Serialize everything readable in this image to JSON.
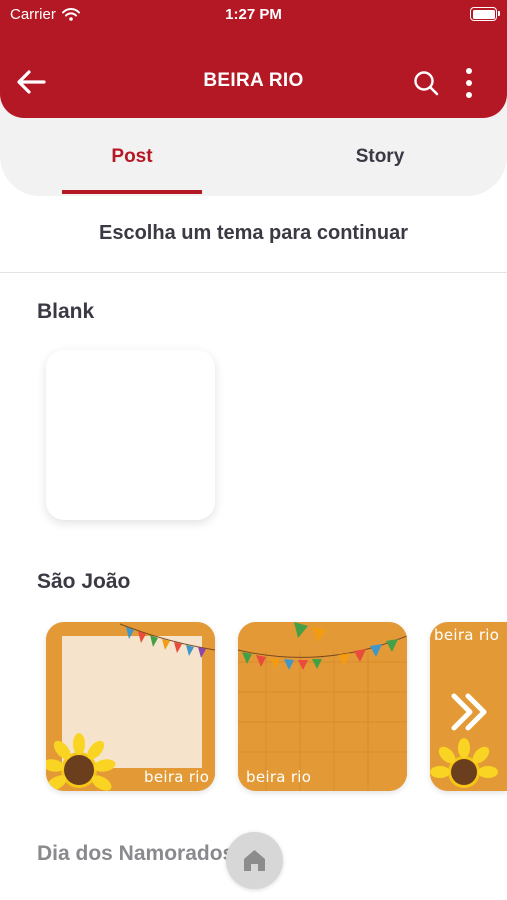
{
  "status_bar": {
    "carrier": "Carrier",
    "time": "1:27 PM"
  },
  "header": {
    "title": "BEIRA RIO",
    "back_icon": "arrow-left-icon",
    "search_icon": "search-icon",
    "menu_icon": "more-vertical-icon"
  },
  "tabs": [
    {
      "label": "Post",
      "selected": true
    },
    {
      "label": "Story",
      "selected": false
    }
  ],
  "subtitle": "Escolha um tema para continuar",
  "sections": {
    "blank": {
      "title": "Blank"
    },
    "sao_joao": {
      "title": "São João",
      "brand_text": "beira rio"
    },
    "namorados": {
      "title": "Dia dos Namorados"
    }
  },
  "colors": {
    "primary": "#b51825",
    "tab_background": "#f2f2f2",
    "text_dark": "#3a3a44",
    "theme_orange": "#e39a36"
  },
  "fab": {
    "icon": "home-icon"
  }
}
